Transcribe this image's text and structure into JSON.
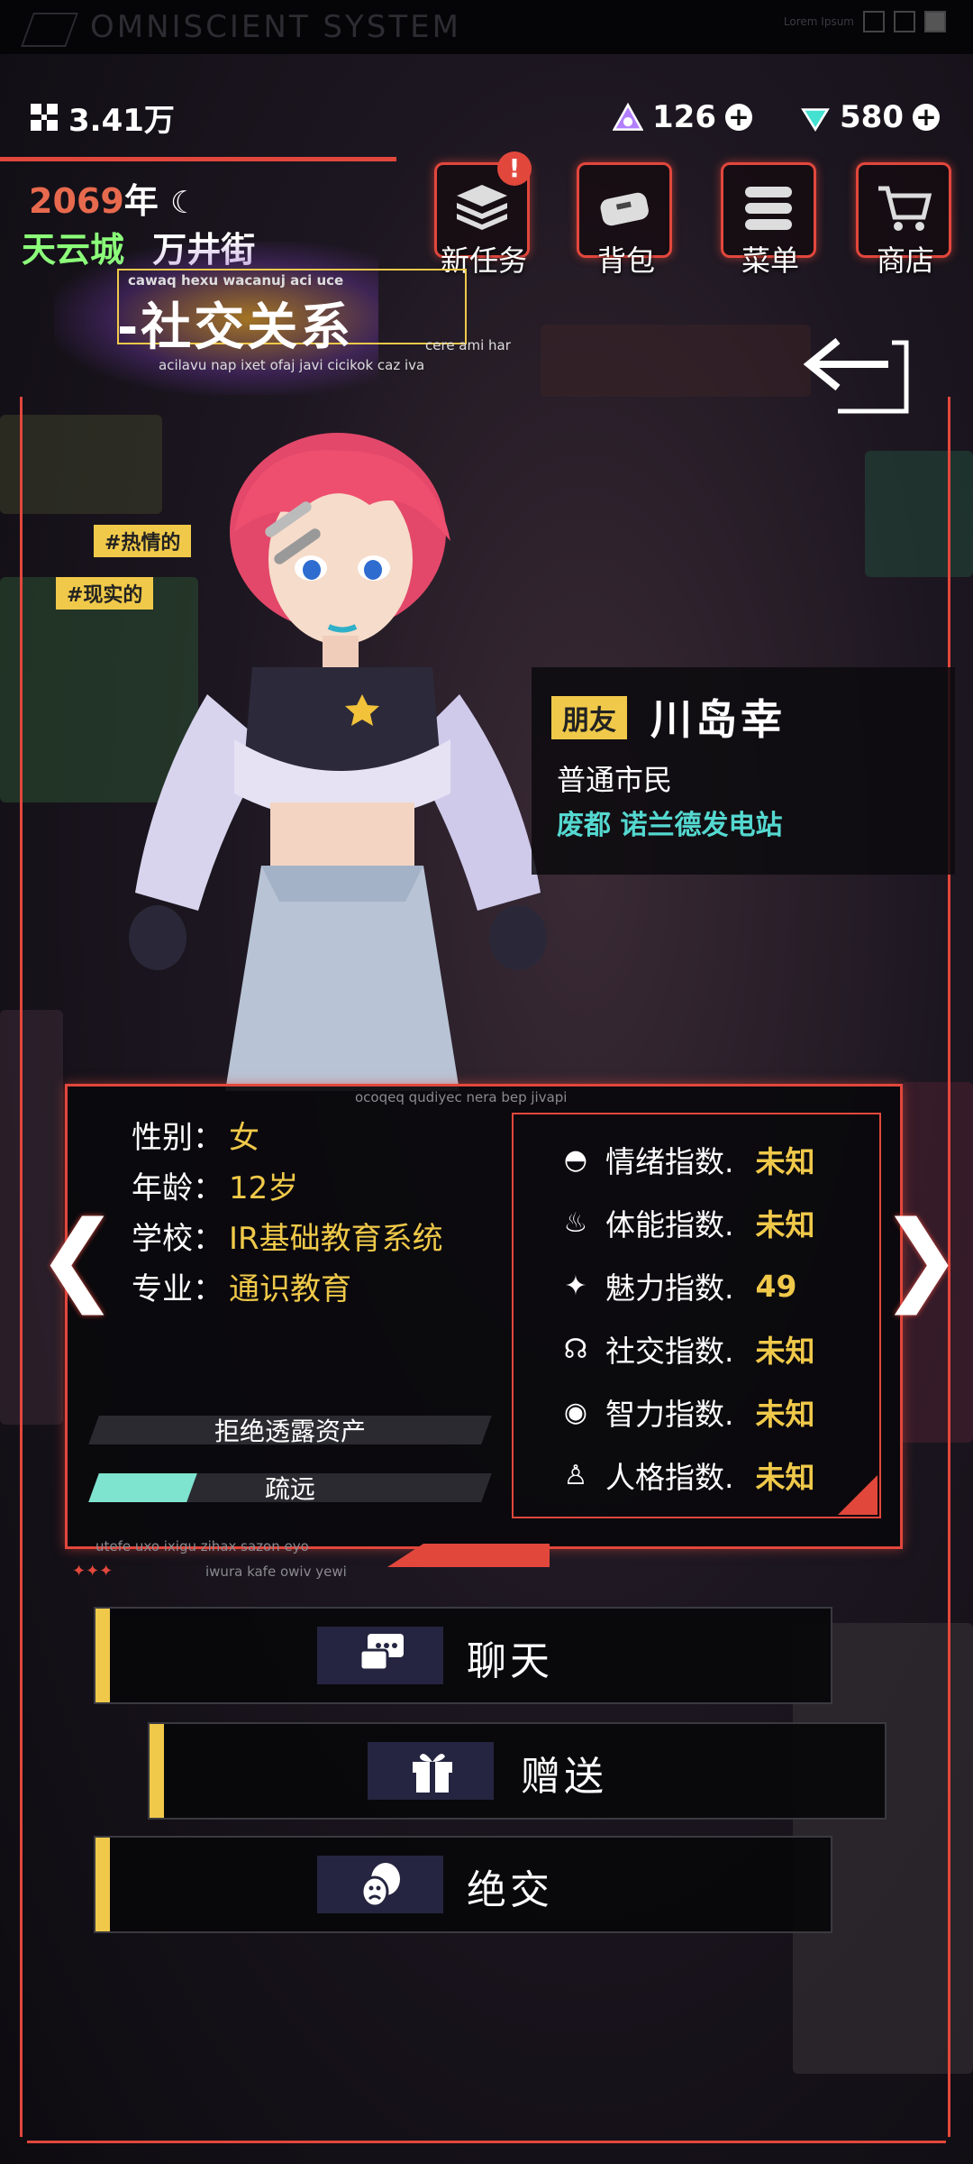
{
  "system": {
    "title": "OMNISCIENT SYSTEM",
    "right_text": "Lorem Ipsum"
  },
  "currency": {
    "coins": "3.41万",
    "tokens": "126",
    "gems": "580"
  },
  "time_location": {
    "year": "2069",
    "year_unit": "年",
    "city": "天云城",
    "street": "万井街"
  },
  "nav": [
    {
      "label": "新任务",
      "icon": "new-task-icon",
      "badge": "!"
    },
    {
      "label": "背包",
      "icon": "backpack-icon"
    },
    {
      "label": "菜单",
      "icon": "menu-icon"
    },
    {
      "label": "商店",
      "icon": "shop-icon"
    }
  ],
  "section": {
    "title": "社交关系",
    "caption_top": "cawaq hexu wacanuj aci uce",
    "caption_bottom": "acilavu nap ixet ofaj javi cicikok caz iva",
    "caption_right": "cere ami har"
  },
  "tags": [
    "#热情的",
    "#现实的"
  ],
  "character": {
    "relation": "朋友",
    "name": "川岛幸",
    "job": "普通市民",
    "location_a": "废都",
    "location_b": "诺兰德发电站"
  },
  "info": {
    "header_caption": "ocoqeq qudiyec nera bep jivapi",
    "rows": [
      {
        "label": "性别：",
        "value": "女"
      },
      {
        "label": "年龄：",
        "value": "12岁"
      },
      {
        "label": "学校：",
        "value": "IR基础教育系统"
      },
      {
        "label": "专业：",
        "value": "通识教育"
      }
    ],
    "bars": [
      {
        "label": "拒绝透露资产",
        "fill": 0
      },
      {
        "label": "疏远",
        "fill": 0.25
      }
    ],
    "footer_caption_1": "utefe uxo ixigu zihax sazon eyo",
    "footer_caption_2": "iwura kafe owiv yewi",
    "stars": "✦✦✦"
  },
  "stats": [
    {
      "label": "情绪指数.",
      "value": "未知",
      "icon": "emotion-icon"
    },
    {
      "label": "体能指数.",
      "value": "未知",
      "icon": "stamina-icon"
    },
    {
      "label": "魅力指数.",
      "value": "49",
      "icon": "charm-icon"
    },
    {
      "label": "社交指数.",
      "value": "未知",
      "icon": "social-icon"
    },
    {
      "label": "智力指数.",
      "value": "未知",
      "icon": "intelligence-icon"
    },
    {
      "label": "人格指数.",
      "value": "未知",
      "icon": "personality-icon"
    }
  ],
  "actions": {
    "chat": "聊天",
    "gift": "赠送",
    "break": "绝交"
  },
  "colors": {
    "accent_red": "#e2473c",
    "accent_yellow": "#f0c94a",
    "teal": "#54d8d0",
    "bar_fill": "#7ee3cf"
  }
}
